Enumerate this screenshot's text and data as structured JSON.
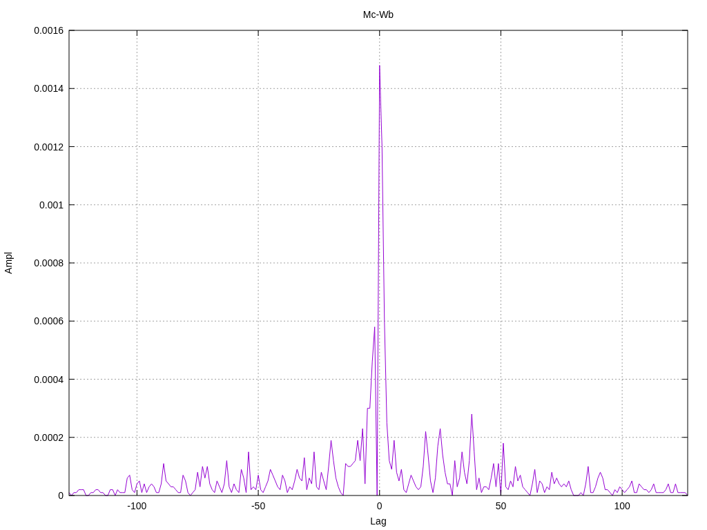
{
  "chart_data": {
    "type": "line",
    "grid": true,
    "title": "Mc-Wb",
    "xlabel": "Lag",
    "ylabel": "Ampl",
    "xlim": [
      -128,
      127
    ],
    "ylim": [
      0,
      0.0016
    ],
    "xticks": [
      -100,
      -50,
      0,
      50,
      100
    ],
    "yticks": [
      0,
      0.0002,
      0.0004,
      0.0006,
      0.0008,
      0.001,
      0.0012,
      0.0014,
      0.0016
    ],
    "x": [
      -128,
      -127,
      -126,
      -125,
      -124,
      -123,
      -122,
      -121,
      -120,
      -119,
      -118,
      -117,
      -116,
      -115,
      -114,
      -113,
      -112,
      -111,
      -110,
      -109,
      -108,
      -107,
      -106,
      -105,
      -104,
      -103,
      -102,
      -101,
      -100,
      -99,
      -98,
      -97,
      -96,
      -95,
      -94,
      -93,
      -92,
      -91,
      -90,
      -89,
      -88,
      -87,
      -86,
      -85,
      -84,
      -83,
      -82,
      -81,
      -80,
      -79,
      -78,
      -77,
      -76,
      -75,
      -74,
      -73,
      -72,
      -71,
      -70,
      -69,
      -68,
      -67,
      -66,
      -65,
      -64,
      -63,
      -62,
      -61,
      -60,
      -59,
      -58,
      -57,
      -56,
      -55,
      -54,
      -53,
      -52,
      -51,
      -50,
      -49,
      -48,
      -47,
      -46,
      -45,
      -44,
      -43,
      -42,
      -41,
      -40,
      -39,
      -38,
      -37,
      -36,
      -35,
      -34,
      -33,
      -32,
      -31,
      -30,
      -29,
      -28,
      -27,
      -26,
      -25,
      -24,
      -23,
      -22,
      -21,
      -20,
      -19,
      -18,
      -17,
      -16,
      -15,
      -14,
      -13,
      -12,
      -11,
      -10,
      -9,
      -8,
      -7,
      -6,
      -5,
      -4,
      -3,
      -2,
      -1,
      0,
      1,
      2,
      3,
      4,
      5,
      6,
      7,
      8,
      9,
      10,
      11,
      12,
      13,
      14,
      15,
      16,
      17,
      18,
      19,
      20,
      21,
      22,
      23,
      24,
      25,
      26,
      27,
      28,
      29,
      30,
      31,
      32,
      33,
      34,
      35,
      36,
      37,
      38,
      39,
      40,
      41,
      42,
      43,
      44,
      45,
      46,
      47,
      48,
      49,
      50,
      51,
      52,
      53,
      54,
      55,
      56,
      57,
      58,
      59,
      60,
      61,
      62,
      63,
      64,
      65,
      66,
      67,
      68,
      69,
      70,
      71,
      72,
      73,
      74,
      75,
      76,
      77,
      78,
      79,
      80,
      81,
      82,
      83,
      84,
      85,
      86,
      87,
      88,
      89,
      90,
      91,
      92,
      93,
      94,
      95,
      96,
      97,
      98,
      99,
      100,
      101,
      102,
      103,
      104,
      105,
      106,
      107,
      108,
      109,
      110,
      111,
      112,
      113,
      114,
      115,
      116,
      117,
      118,
      119,
      120,
      121,
      122,
      123,
      124,
      125,
      126,
      127
    ],
    "series": [
      {
        "color": "#9400d3",
        "values": [
          1e-05,
          0,
          1e-05,
          1e-05,
          2e-05,
          2e-05,
          2e-05,
          0,
          0,
          1e-05,
          1e-05,
          2e-05,
          2e-05,
          1e-05,
          1e-05,
          0,
          0,
          2e-05,
          2e-05,
          0,
          2e-05,
          1e-05,
          1e-05,
          1e-05,
          6e-05,
          7e-05,
          2e-05,
          1e-05,
          4e-05,
          5e-05,
          1e-05,
          4e-05,
          1e-05,
          3e-05,
          4e-05,
          3e-05,
          1e-05,
          1e-05,
          4e-05,
          0.00011,
          5e-05,
          4e-05,
          3e-05,
          3e-05,
          2e-05,
          1e-05,
          1e-05,
          7e-05,
          5e-05,
          1e-05,
          0,
          1e-05,
          2e-05,
          8e-05,
          3e-05,
          0.0001,
          6e-05,
          0.0001,
          4e-05,
          2e-05,
          1e-05,
          5e-05,
          3e-05,
          1e-05,
          4e-05,
          0.00012,
          3e-05,
          1e-05,
          4e-05,
          2e-05,
          1e-05,
          9e-05,
          6e-05,
          1e-05,
          0.00015,
          2e-05,
          3e-05,
          2e-05,
          7e-05,
          2e-05,
          1e-05,
          3e-05,
          5e-05,
          9e-05,
          7e-05,
          5e-05,
          3e-05,
          2e-05,
          7e-05,
          5e-05,
          1e-05,
          3e-05,
          2e-05,
          5e-05,
          9e-05,
          6e-05,
          5e-05,
          0.00013,
          2e-05,
          6e-05,
          4e-05,
          0.00015,
          3e-05,
          2e-05,
          8e-05,
          5e-05,
          2e-05,
          0.0001,
          0.00019,
          0.00012,
          6e-05,
          3e-05,
          1e-05,
          0,
          0.00011,
          0.0001,
          0.0001,
          0.00011,
          0.00012,
          0.00019,
          0.00012,
          0.00023,
          4e-05,
          0.0003,
          0.0003,
          0.00046,
          0.00058,
          0,
          0.00148,
          0.0012,
          0.0006,
          0.00025,
          0.00012,
          9e-05,
          0.00019,
          8e-05,
          5e-05,
          9e-05,
          2e-05,
          1e-05,
          4e-05,
          7e-05,
          5e-05,
          3e-05,
          2e-05,
          3e-05,
          0.0001,
          0.00022,
          0.00014,
          5e-05,
          1e-05,
          6e-05,
          0.00017,
          0.00023,
          0.00014,
          8e-05,
          4e-05,
          4e-05,
          0,
          0.00012,
          3e-05,
          6e-05,
          0.00015,
          8e-05,
          4e-05,
          0.00012,
          0.00028,
          0.00015,
          2e-05,
          6e-05,
          1e-05,
          3e-05,
          3e-05,
          2e-05,
          6e-05,
          0.00011,
          3e-05,
          0.00011,
          0,
          0.00018,
          3e-05,
          2e-05,
          5e-05,
          3e-05,
          0.0001,
          5e-05,
          7e-05,
          3e-05,
          2e-05,
          1e-05,
          0,
          4e-05,
          9e-05,
          1e-05,
          5e-05,
          4e-05,
          1e-05,
          3e-05,
          2e-05,
          8e-05,
          4e-05,
          6e-05,
          4e-05,
          3e-05,
          4e-05,
          3e-05,
          5e-05,
          2e-05,
          0,
          0,
          0,
          1e-05,
          0,
          4e-05,
          0.0001,
          1e-05,
          1e-05,
          3e-05,
          6e-05,
          8e-05,
          6e-05,
          2e-05,
          2e-05,
          1e-05,
          0,
          2e-05,
          1e-05,
          3e-05,
          2e-05,
          1e-05,
          2e-05,
          3e-05,
          5e-05,
          1e-05,
          1e-05,
          4e-05,
          3e-05,
          2e-05,
          2e-05,
          1e-05,
          2e-05,
          4e-05,
          1e-05,
          1e-05,
          1e-05,
          1e-05,
          2e-05,
          4e-05,
          1e-05,
          1e-05,
          4e-05,
          1e-05,
          1e-05,
          1e-05,
          1e-05,
          0
        ]
      }
    ]
  }
}
